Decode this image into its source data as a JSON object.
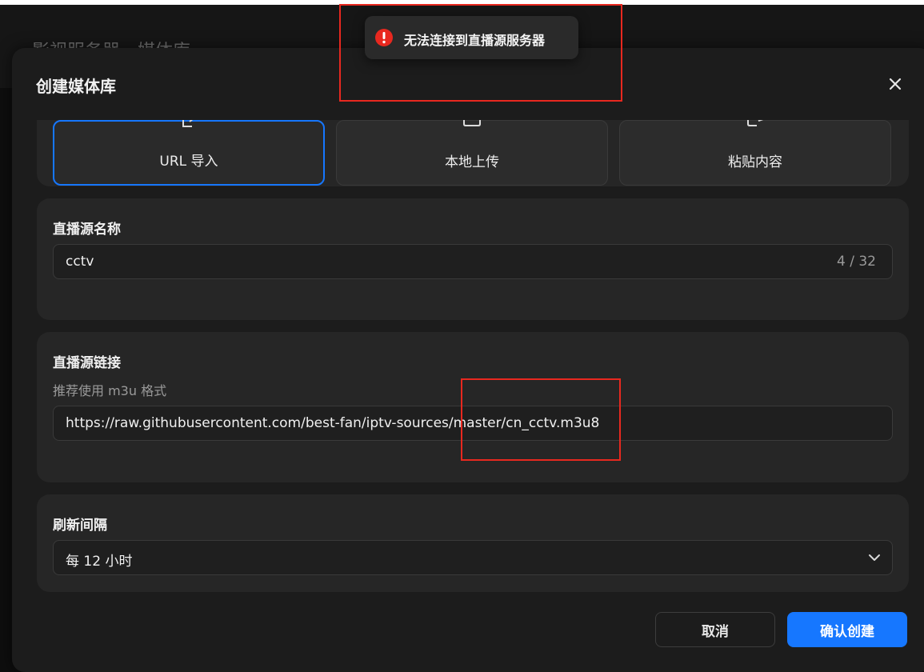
{
  "background": {
    "title": "影视服务器 - 媒体库"
  },
  "modal": {
    "title": "创建媒体库",
    "close_icon": "close-icon"
  },
  "import_tabs": [
    {
      "label": "URL 导入",
      "active": true,
      "icon": "url-import-icon"
    },
    {
      "label": "本地上传",
      "active": false,
      "icon": "upload-icon"
    },
    {
      "label": "粘贴内容",
      "active": false,
      "icon": "paste-icon"
    }
  ],
  "source_name": {
    "label": "直播源名称",
    "value": "cctv",
    "counter": "4 / 32"
  },
  "source_url": {
    "label": "直播源链接",
    "hint": "推荐使用 m3u 格式",
    "value": "https://raw.githubusercontent.com/best-fan/iptv-sources/master/cn_cctv.m3u8"
  },
  "refresh": {
    "label": "刷新间隔",
    "selected": "每 12 小时",
    "chevron_icon": "chevron-down-icon"
  },
  "footer": {
    "cancel_label": "取消",
    "confirm_label": "确认创建"
  },
  "toast": {
    "icon": "error-icon",
    "message": "无法连接到直播源服务器"
  },
  "colors": {
    "accent": "#1677ff",
    "error": "#e8281f",
    "annotation": "#e8281f"
  }
}
